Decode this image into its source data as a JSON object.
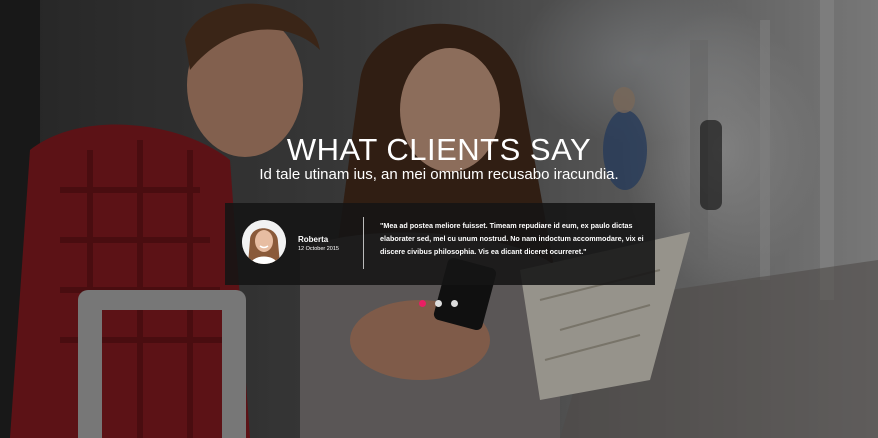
{
  "section": {
    "title": "WHAT CLIENTS SAY",
    "subtitle": "Id tale utinam ius, an mei omnium recusabo iracundia."
  },
  "testimonial": {
    "author": "Roberta",
    "date": "12 October 2015",
    "quote": "\"Mea ad postea meliore fuisset. Timeam repudiare id eum, ex paulo dictas elaborater sed, mel cu unum nostrud. No nam indoctum accommodare, vix ei discere civibus philosophia. Vis ea dicant diceret ocurreret.\""
  },
  "carousel": {
    "active_index": 0,
    "dots": 3,
    "active_color": "#e91e63",
    "inactive_color": "#dddddd"
  },
  "colors": {
    "card_bg": "#141414",
    "text": "#ffffff"
  },
  "images": {
    "background": "hero-background-photo",
    "avatar": "avatar-photo"
  }
}
